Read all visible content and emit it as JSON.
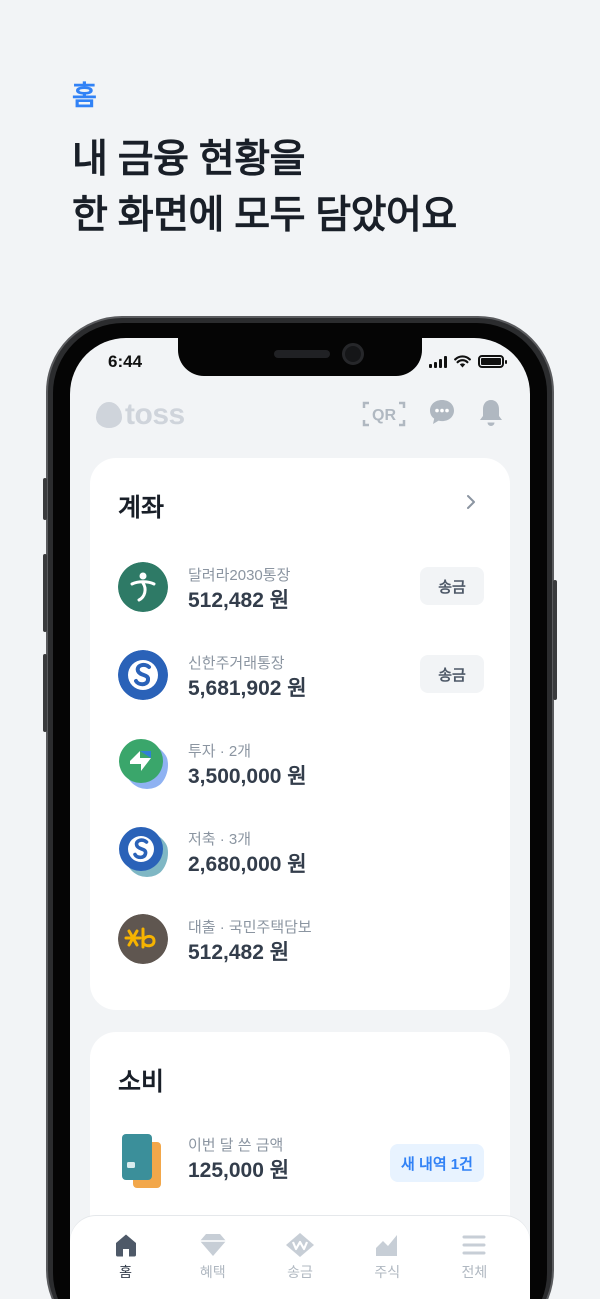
{
  "promo": {
    "tag": "홈",
    "title_line1": "내 금융 현황을",
    "title_line2": "한 화면에 모두 담았어요"
  },
  "status_bar": {
    "time": "6:44"
  },
  "header": {
    "logo_text": "toss",
    "qr_label": "QR",
    "icons": [
      "qr-icon",
      "chat-icon",
      "bell-icon"
    ]
  },
  "accounts": {
    "title": "계좌",
    "items": [
      {
        "name": "달려라2030통장",
        "balance": "512,482 원",
        "action": "송금",
        "logo_color": "#2e7a66",
        "icon": "hana-bank-logo"
      },
      {
        "name": "신한주거래통장",
        "balance": "5,681,902 원",
        "action": "송금",
        "logo_color": "#2a62b8",
        "icon": "shinhan-bank-logo"
      },
      {
        "name": "투자 · 2개",
        "balance": "3,500,000 원",
        "logo_color": "#3aa66b",
        "icon": "investment-stack-logo"
      },
      {
        "name": "저축 · 3개",
        "balance": "2,680,000 원",
        "logo_color": "#2a62b8",
        "icon": "savings-stack-logo"
      },
      {
        "name": "대출 · 국민주택담보",
        "balance": "512,482 원",
        "logo_color": "#5f5650",
        "icon": "kb-bank-logo"
      }
    ]
  },
  "spending": {
    "title": "소비",
    "label": "이번 달 쓴 금액",
    "amount": "125,000 원",
    "history_button": "새 내역 1건"
  },
  "tabs": [
    {
      "label": "홈",
      "icon": "home-icon",
      "active": true
    },
    {
      "label": "혜택",
      "icon": "diamond-icon",
      "active": false
    },
    {
      "label": "송금",
      "icon": "transfer-icon",
      "active": false
    },
    {
      "label": "주식",
      "icon": "stock-chart-icon",
      "active": false
    },
    {
      "label": "전체",
      "icon": "menu-icon",
      "active": false
    }
  ],
  "colors": {
    "accent": "#3182f6",
    "background": "#f2f4f6",
    "text_primary": "#191f28",
    "text_secondary": "#8b95a1"
  }
}
